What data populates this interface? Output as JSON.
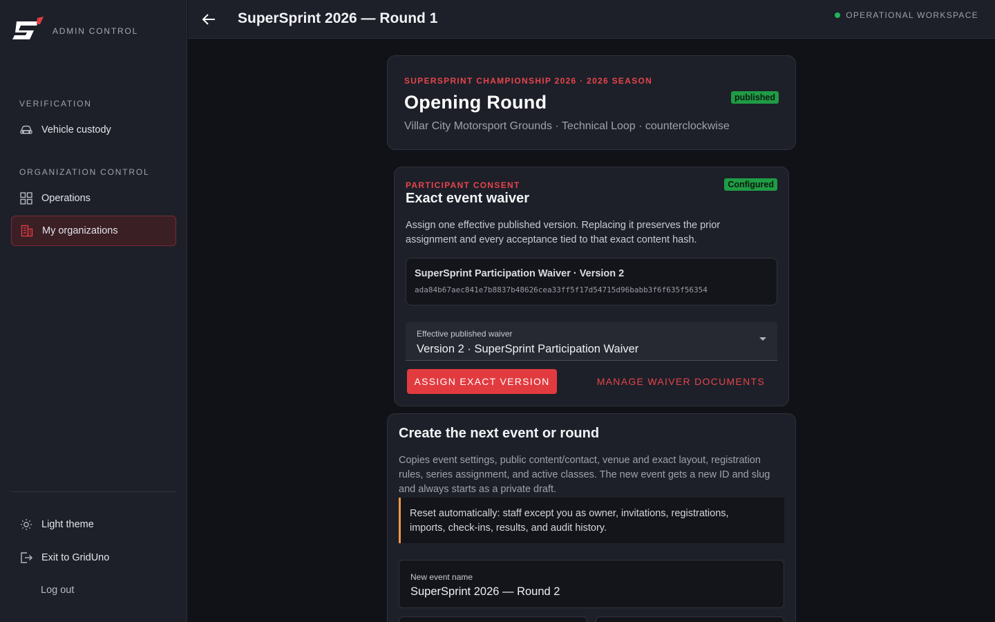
{
  "sidebar": {
    "brand_label": "ADMIN CONTROL",
    "sections": [
      {
        "title": "VERIFICATION"
      },
      {
        "title": "ORGANIZATION CONTROL"
      }
    ],
    "items": [
      {
        "label": "Vehicle custody",
        "icon": "car-icon"
      },
      {
        "label": "Operations",
        "icon": "grid-icon"
      },
      {
        "label": "My organizations",
        "icon": "building-icon",
        "active": true
      }
    ],
    "footer": {
      "theme_label": "Light theme",
      "exit_label": "Exit to GridUno",
      "logout_label": "Log out"
    }
  },
  "topbar": {
    "title": "SuperSprint 2026 — Round 1",
    "workspace_status": "OPERATIONAL WORKSPACE"
  },
  "hero": {
    "eyebrow": "SUPERSPRINT CHAMPIONSHIP 2026 · 2026 SEASON",
    "title": "Opening Round",
    "status": "published",
    "subtitle": "Villar City Motorsport Grounds · Technical Loop · counterclockwise"
  },
  "waiver": {
    "eyebrow": "PARTICIPANT CONSENT",
    "status": "Configured",
    "title": "Exact event waiver",
    "description": "Assign one effective published version. Replacing it preserves the prior assignment and every acceptance tied to that exact content hash.",
    "document_name": "SuperSprint Participation Waiver · Version 2",
    "document_hash": "ada84b67aec841e7b8837b48626cea33ff5f17d54715d96babb3f6f635f56354",
    "select_label": "Effective published waiver",
    "select_value": "Version 2 · SuperSprint Participation Waiver",
    "assign_button": "ASSIGN EXACT VERSION",
    "manage_button": "MANAGE WAIVER DOCUMENTS"
  },
  "next_event": {
    "title": "Create the next event or round",
    "description": "Copies event settings, public content/contact, venue and exact layout, registration rules, series assignment, and active classes. The new event gets a new ID and slug and always starts as a private draft.",
    "reset_note": "Reset automatically: staff except you as owner, invitations, registrations, imports, check-ins, results, and audit history.",
    "name_label": "New event name",
    "name_value": "SuperSprint 2026 — Round 2"
  },
  "colors": {
    "accent": "#e23b3f",
    "success": "#1f9c45",
    "warning": "#f0974a",
    "background": "#111217",
    "surface": "#1d2029"
  }
}
